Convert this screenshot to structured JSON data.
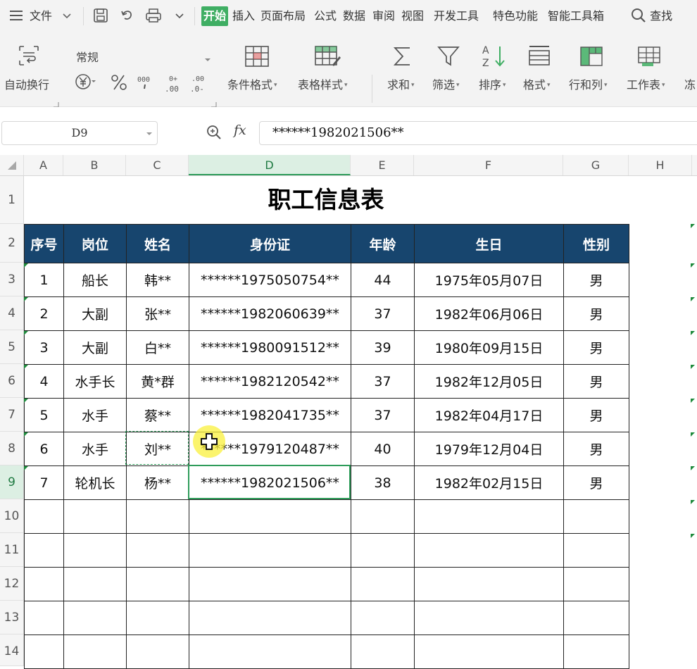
{
  "menubar": {
    "file": "文件",
    "tabs": [
      "开始",
      "插入",
      "页面布局",
      "公式",
      "数据",
      "审阅",
      "视图",
      "开发工具",
      "特色功能",
      "智能工具箱"
    ],
    "active_tab": "开始",
    "search": "查找"
  },
  "ribbon": {
    "wrap_text": "自动换行",
    "number_format": "常规",
    "cond_format": "条件格式",
    "table_style": "表格样式",
    "sum": "求和",
    "filter": "筛选",
    "sort": "排序",
    "format": "格式",
    "row_col": "行和列",
    "worksheet": "工作表",
    "freeze": "冻"
  },
  "formula_bar": {
    "cell_ref": "D9",
    "fx": "fx",
    "content": "******1982021506**"
  },
  "columns": [
    "A",
    "B",
    "C",
    "D",
    "E",
    "F",
    "G",
    "H"
  ],
  "selected_column": "D",
  "rows": [
    "1",
    "2",
    "3",
    "4",
    "5",
    "6",
    "7",
    "8",
    "9",
    "10",
    "11",
    "12",
    "13",
    "14"
  ],
  "selected_row": "9",
  "sheet": {
    "title": "职工信息表",
    "headers": [
      "序号",
      "岗位",
      "姓名",
      "身份证",
      "年龄",
      "生日",
      "性别"
    ],
    "data": [
      [
        "1",
        "船长",
        "韩**",
        "******1975050754**",
        "44",
        "1975年05月07日",
        "男"
      ],
      [
        "2",
        "大副",
        "张**",
        "******1982060639**",
        "37",
        "1982年06月06日",
        "男"
      ],
      [
        "3",
        "大副",
        "白**",
        "******1980091512**",
        "39",
        "1980年09月15日",
        "男"
      ],
      [
        "4",
        "水手长",
        "黄*群",
        "******1982120542**",
        "37",
        "1982年12月05日",
        "男"
      ],
      [
        "5",
        "水手",
        "蔡**",
        "******1982041735**",
        "37",
        "1982年04月17日",
        "男"
      ],
      [
        "6",
        "水手",
        "刘**",
        "******1979120487**",
        "40",
        "1979年12月04日",
        "男"
      ],
      [
        "7",
        "轮机长",
        "杨**",
        "******1982021506**",
        "38",
        "1982年02月15日",
        "男"
      ]
    ],
    "empty_rows": 5
  },
  "colors": {
    "accent": "#3fae63",
    "header_bg": "#17456e",
    "selection": "#2e9c5a"
  }
}
